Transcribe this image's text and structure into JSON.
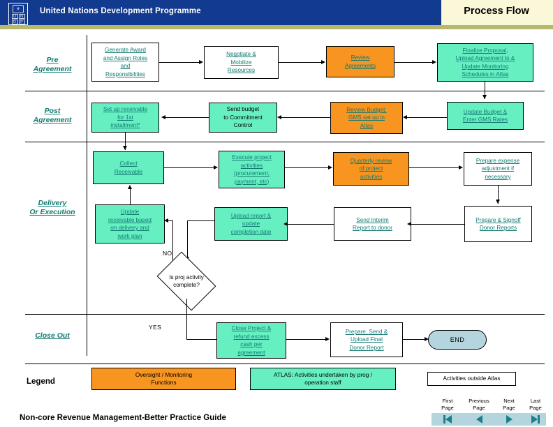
{
  "header": {
    "org_title": "United Nations Development Programme",
    "doc_title": "Process Flow",
    "logo_name": "undp-logo",
    "logo_letters": [
      "U",
      "N",
      "D",
      "P"
    ]
  },
  "lanes": [
    {
      "id": "pre-agreement",
      "label": "Pre\nAgreement"
    },
    {
      "id": "post-agreement",
      "label": "Post\nAgreement"
    },
    {
      "id": "delivery-execution",
      "label": "Delivery\nOr Execution"
    },
    {
      "id": "close-out",
      "label": "Close Out"
    }
  ],
  "lane_labels": {
    "pre_line1": "Pre",
    "pre_line2": "Agreement",
    "post_line1": "Post",
    "post_line2": "Agreement",
    "delivery_line1": "Delivery",
    "delivery_line2": "Or Execution",
    "closeout": "Close Out"
  },
  "nodes": {
    "generate_award": {
      "lines": [
        "Generate Award",
        "and Assign Roles",
        "and",
        "Responsibilities"
      ],
      "style": "white",
      "text": "link"
    },
    "negotiate_mobilize": {
      "lines": [
        "Negotiate &",
        "Mobilize",
        "Resources"
      ],
      "style": "white",
      "text": "link"
    },
    "review_agreements": {
      "lines": [
        "Review",
        "Agreements"
      ],
      "style": "orange",
      "text": "link"
    },
    "finalize_proposal": {
      "lines": [
        "Finalize Proposal,",
        "Upload Agreement to &",
        "Update Monitoring",
        "Schedules in Atlas"
      ],
      "style": "teal",
      "text": "link"
    },
    "setup_receivable": {
      "lines": [
        "Set up receivable",
        "for 1st",
        "installment*"
      ],
      "style": "teal",
      "text": "link"
    },
    "send_budget": {
      "lines": [
        "Send budget",
        "to Commitment",
        "Control"
      ],
      "style": "teal",
      "text": "plain"
    },
    "review_budget_gms": {
      "lines": [
        "Review Budget,",
        "GMS set up in",
        "Atlas"
      ],
      "style": "orange",
      "text": "link"
    },
    "update_budget_gms": {
      "lines": [
        "Update Budget &",
        "Enter GMS Rates"
      ],
      "style": "teal",
      "text": "link"
    },
    "collect_receivable": {
      "lines": [
        "Collect",
        "Receivable"
      ],
      "style": "teal",
      "text": "link"
    },
    "execute_project": {
      "lines": [
        "Execute project",
        "activities",
        "(procurement,",
        "payment, etc)"
      ],
      "style": "teal",
      "text": "link"
    },
    "quarterly_review": {
      "lines": [
        "Quarterly review",
        "of project",
        "activities"
      ],
      "style": "orange",
      "text": "link"
    },
    "prepare_expense": {
      "lines": [
        "Prepare expense",
        "adjustment if",
        "necessary"
      ],
      "style": "white",
      "text": "link"
    },
    "update_receivable": {
      "lines": [
        "Update",
        "receivable based",
        "on delivery and",
        "work plan"
      ],
      "style": "teal",
      "text": "link"
    },
    "upload_report": {
      "lines": [
        "Upload report &",
        "update",
        "completion date"
      ],
      "style": "teal",
      "text": "link"
    },
    "send_interim_report": {
      "lines": [
        "Send Interim",
        "Report to donor"
      ],
      "style": "white",
      "text": "link"
    },
    "prepare_signoff": {
      "lines": [
        "Prepare & Signoff",
        "Donor Reports"
      ],
      "style": "white",
      "text": "link"
    },
    "close_project": {
      "lines": [
        "Close Project &",
        "refund excess",
        "cash per",
        "agreement"
      ],
      "style": "teal",
      "text": "link"
    },
    "prepare_send_final": {
      "lines": [
        "Prepare, Send  &",
        "Upload Final",
        "Donor Report"
      ],
      "style": "white",
      "text": "link"
    },
    "decision": {
      "lines": [
        "Is proj activity",
        "complete?"
      ],
      "style": "diamond",
      "text": "plain"
    },
    "end": {
      "lines": [
        "END"
      ],
      "style": "terminator",
      "text": "plain"
    }
  },
  "edge_labels": {
    "no": "NO",
    "yes": "YES"
  },
  "legend": {
    "title": "Legend",
    "items": [
      {
        "id": "oversight",
        "lines": [
          "Oversight / Monitoring",
          "Functions"
        ],
        "color": "#f79520"
      },
      {
        "id": "atlas",
        "lines": [
          "ATLAS:  Activities undertaken by prog /",
          "operation staff"
        ],
        "color": "#66f0c2"
      },
      {
        "id": "outside-atlas",
        "lines": [
          "Activities outside Atlas"
        ],
        "color": "#ffffff"
      }
    ]
  },
  "footer": {
    "doc_name": "Non-core Revenue Management-Better Practice Guide",
    "nav": [
      {
        "id": "first-page",
        "line1": "First",
        "line2": "Page",
        "icon": "first-page-icon"
      },
      {
        "id": "previous-page",
        "line1": "Previous",
        "line2": "Page",
        "icon": "previous-page-icon"
      },
      {
        "id": "next-page",
        "line1": "Next",
        "line2": "Page",
        "icon": "next-page-icon"
      },
      {
        "id": "last-page",
        "line1": "Last",
        "line2": "Page",
        "icon": "last-page-icon"
      }
    ]
  },
  "colors": {
    "header_blue": "#123a8f",
    "header_cream": "#fbf8d9",
    "header_olive": "#b6b96c",
    "teal_fill": "#66f0c2",
    "orange_fill": "#f79520",
    "link_text": "#137a72",
    "end_fill": "#b4d5dd"
  }
}
